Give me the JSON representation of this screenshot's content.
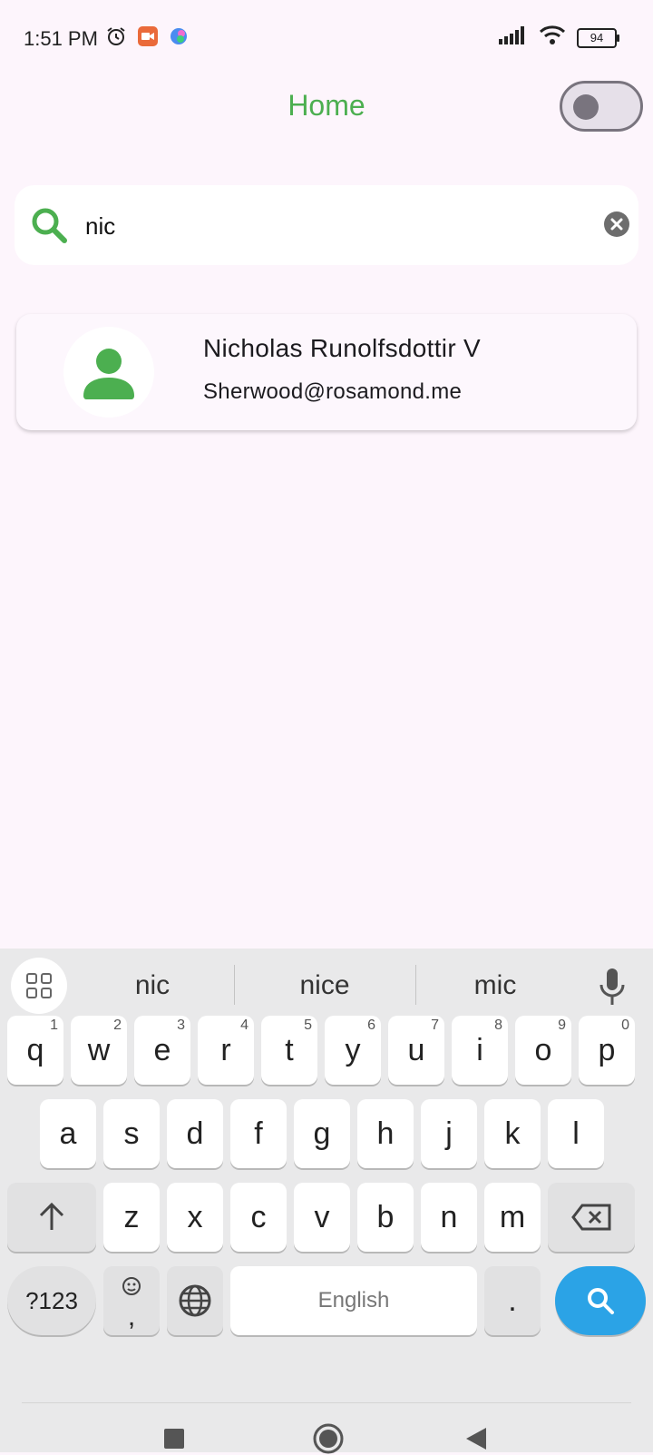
{
  "status": {
    "time": "1:51 PM",
    "battery": "94"
  },
  "header": {
    "title": "Home",
    "theme_toggle": "off"
  },
  "search": {
    "query": "nic"
  },
  "results": [
    {
      "name": "Nicholas Runolfsdottir V",
      "email": "Sherwood@rosamond.me"
    }
  ],
  "colors": {
    "accent": "#4caf50",
    "keyboard_action": "#2ba3e6",
    "background": "#fdf5fc"
  },
  "keyboard": {
    "suggestions": [
      "nic",
      "nice",
      "mic"
    ],
    "row1": [
      {
        "key": "q",
        "hint": "1"
      },
      {
        "key": "w",
        "hint": "2"
      },
      {
        "key": "e",
        "hint": "3"
      },
      {
        "key": "r",
        "hint": "4"
      },
      {
        "key": "t",
        "hint": "5"
      },
      {
        "key": "y",
        "hint": "6"
      },
      {
        "key": "u",
        "hint": "7"
      },
      {
        "key": "i",
        "hint": "8"
      },
      {
        "key": "o",
        "hint": "9"
      },
      {
        "key": "p",
        "hint": "0"
      }
    ],
    "row2": [
      "a",
      "s",
      "d",
      "f",
      "g",
      "h",
      "j",
      "k",
      "l"
    ],
    "row3": [
      "z",
      "x",
      "c",
      "v",
      "b",
      "n",
      "m"
    ],
    "symbols_label": "?123",
    "emoji_comma": ",",
    "space_label": "English",
    "period": "."
  }
}
